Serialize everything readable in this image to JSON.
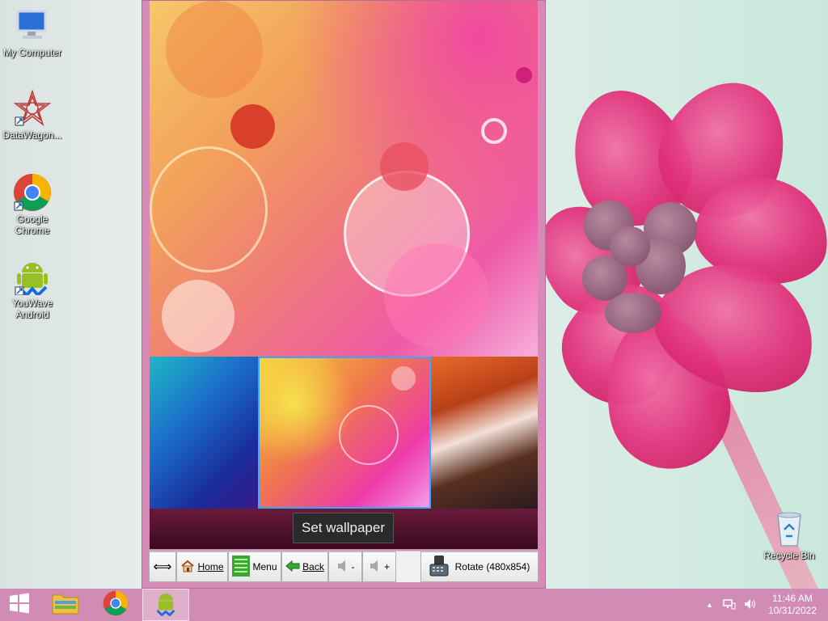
{
  "desktop": {
    "icons": [
      {
        "label": "My Computer",
        "icon": "computer-icon"
      },
      {
        "label": "DataWagon...",
        "icon": "datawagon-icon"
      },
      {
        "label": "Google Chrome",
        "icon": "chrome-icon"
      },
      {
        "label": "YouWave Android",
        "icon": "android-icon"
      },
      {
        "label": "Recycle Bin",
        "icon": "recycle-bin-icon"
      }
    ]
  },
  "emulator": {
    "set_wallpaper_label": "Set wallpaper",
    "toolbar": {
      "resize": "⟺",
      "home": "Home",
      "menu": "Menu",
      "back": "Back",
      "vol_down": "-",
      "vol_up": "+",
      "rotate": "Rotate (480x854)"
    }
  },
  "taskbar": {
    "clock_time": "11:46 AM",
    "clock_date": "10/31/2022",
    "tray_chevron": "▲"
  }
}
